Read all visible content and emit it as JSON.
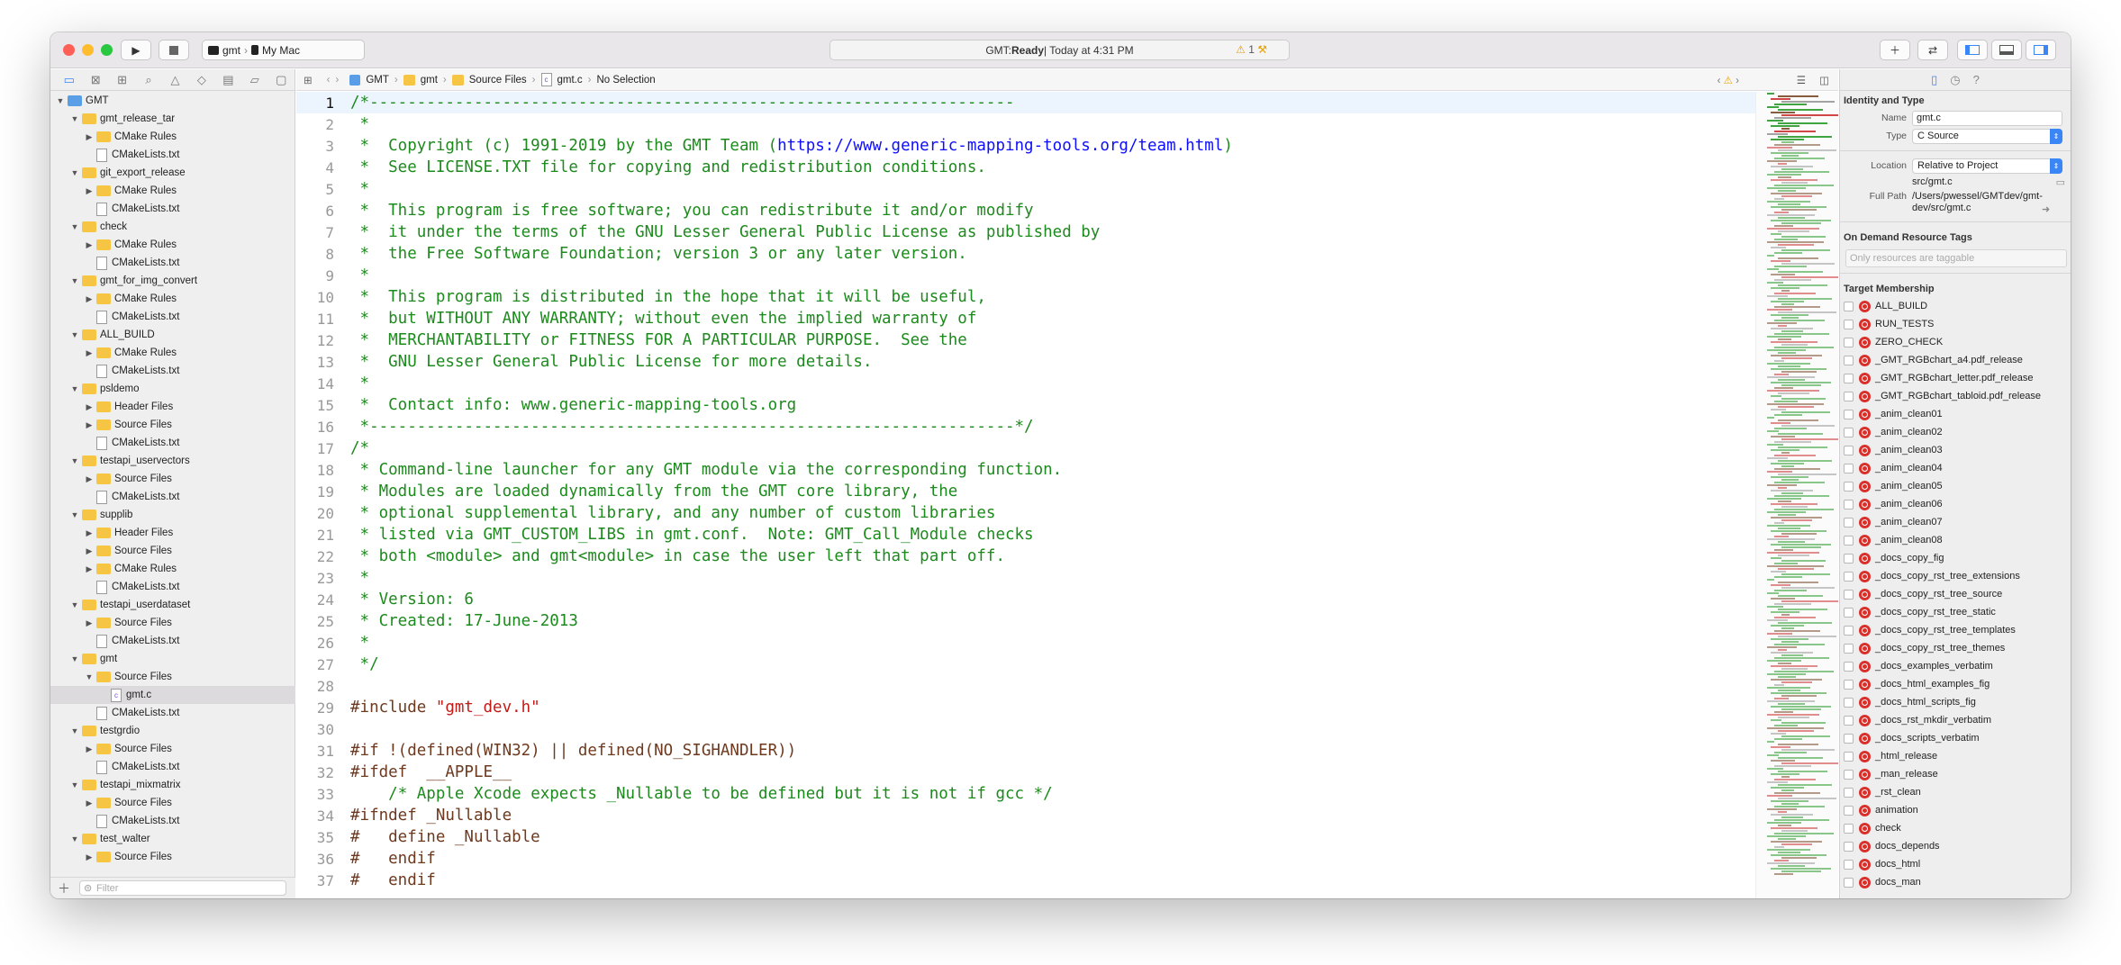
{
  "toolbar": {
    "scheme_target": "gmt",
    "scheme_device": "My Mac",
    "activity_app": "GMT: ",
    "activity_status": "Ready",
    "activity_time": " | Today at 4:31 PM",
    "warning_count": "1"
  },
  "jumpbar": {
    "crumbs": [
      "GMT",
      "gmt",
      "Source Files",
      "gmt.c"
    ],
    "selection": "No Selection"
  },
  "navigator": {
    "filter_placeholder": "Filter",
    "items": [
      {
        "label": "GMT",
        "depth": 0,
        "kind": "project",
        "tri": "▼"
      },
      {
        "label": "gmt_release_tar",
        "depth": 1,
        "kind": "folder",
        "tri": "▼"
      },
      {
        "label": "CMake Rules",
        "depth": 2,
        "kind": "folder",
        "tri": "▶"
      },
      {
        "label": "CMakeLists.txt",
        "depth": 2,
        "kind": "file",
        "tri": ""
      },
      {
        "label": "git_export_release",
        "depth": 1,
        "kind": "folder",
        "tri": "▼"
      },
      {
        "label": "CMake Rules",
        "depth": 2,
        "kind": "folder",
        "tri": "▶"
      },
      {
        "label": "CMakeLists.txt",
        "depth": 2,
        "kind": "file",
        "tri": ""
      },
      {
        "label": "check",
        "depth": 1,
        "kind": "folder",
        "tri": "▼"
      },
      {
        "label": "CMake Rules",
        "depth": 2,
        "kind": "folder",
        "tri": "▶"
      },
      {
        "label": "CMakeLists.txt",
        "depth": 2,
        "kind": "file",
        "tri": ""
      },
      {
        "label": "gmt_for_img_convert",
        "depth": 1,
        "kind": "folder",
        "tri": "▼"
      },
      {
        "label": "CMake Rules",
        "depth": 2,
        "kind": "folder",
        "tri": "▶"
      },
      {
        "label": "CMakeLists.txt",
        "depth": 2,
        "kind": "file",
        "tri": ""
      },
      {
        "label": "ALL_BUILD",
        "depth": 1,
        "kind": "folder",
        "tri": "▼"
      },
      {
        "label": "CMake Rules",
        "depth": 2,
        "kind": "folder",
        "tri": "▶"
      },
      {
        "label": "CMakeLists.txt",
        "depth": 2,
        "kind": "file",
        "tri": ""
      },
      {
        "label": "psldemo",
        "depth": 1,
        "kind": "folder",
        "tri": "▼"
      },
      {
        "label": "Header Files",
        "depth": 2,
        "kind": "folder",
        "tri": "▶"
      },
      {
        "label": "Source Files",
        "depth": 2,
        "kind": "folder",
        "tri": "▶"
      },
      {
        "label": "CMakeLists.txt",
        "depth": 2,
        "kind": "file",
        "tri": ""
      },
      {
        "label": "testapi_uservectors",
        "depth": 1,
        "kind": "folder",
        "tri": "▼"
      },
      {
        "label": "Source Files",
        "depth": 2,
        "kind": "folder",
        "tri": "▶"
      },
      {
        "label": "CMakeLists.txt",
        "depth": 2,
        "kind": "file",
        "tri": ""
      },
      {
        "label": "supplib",
        "depth": 1,
        "kind": "folder",
        "tri": "▼"
      },
      {
        "label": "Header Files",
        "depth": 2,
        "kind": "folder",
        "tri": "▶"
      },
      {
        "label": "Source Files",
        "depth": 2,
        "kind": "folder",
        "tri": "▶"
      },
      {
        "label": "CMake Rules",
        "depth": 2,
        "kind": "folder",
        "tri": "▶"
      },
      {
        "label": "CMakeLists.txt",
        "depth": 2,
        "kind": "file",
        "tri": ""
      },
      {
        "label": "testapi_userdataset",
        "depth": 1,
        "kind": "folder",
        "tri": "▼"
      },
      {
        "label": "Source Files",
        "depth": 2,
        "kind": "folder",
        "tri": "▶"
      },
      {
        "label": "CMakeLists.txt",
        "depth": 2,
        "kind": "file",
        "tri": ""
      },
      {
        "label": "gmt",
        "depth": 1,
        "kind": "folder",
        "tri": "▼"
      },
      {
        "label": "Source Files",
        "depth": 2,
        "kind": "folder",
        "tri": "▼"
      },
      {
        "label": "gmt.c",
        "depth": 3,
        "kind": "cfile",
        "tri": "",
        "selected": true
      },
      {
        "label": "CMakeLists.txt",
        "depth": 2,
        "kind": "file",
        "tri": ""
      },
      {
        "label": "testgrdio",
        "depth": 1,
        "kind": "folder",
        "tri": "▼"
      },
      {
        "label": "Source Files",
        "depth": 2,
        "kind": "folder",
        "tri": "▶"
      },
      {
        "label": "CMakeLists.txt",
        "depth": 2,
        "kind": "file",
        "tri": ""
      },
      {
        "label": "testapi_mixmatrix",
        "depth": 1,
        "kind": "folder",
        "tri": "▼"
      },
      {
        "label": "Source Files",
        "depth": 2,
        "kind": "folder",
        "tri": "▶"
      },
      {
        "label": "CMakeLists.txt",
        "depth": 2,
        "kind": "file",
        "tri": ""
      },
      {
        "label": "test_walter",
        "depth": 1,
        "kind": "folder",
        "tri": "▼"
      },
      {
        "label": "Source Files",
        "depth": 2,
        "kind": "folder",
        "tri": "▶"
      }
    ]
  },
  "code": [
    {
      "n": "1",
      "t": "/*--------------------------------------------------------------------",
      "c": "c-com"
    },
    {
      "n": "2",
      "t": " *",
      "c": "c-com"
    },
    {
      "n": "3",
      "t": " *  Copyright (c) 1991-2019 by the GMT Team (",
      "c": "c-com",
      "url": "https://www.generic-mapping-tools.org/team.html",
      "after": ")"
    },
    {
      "n": "4",
      "t": " *  See LICENSE.TXT file for copying and redistribution conditions.",
      "c": "c-com"
    },
    {
      "n": "5",
      "t": " *",
      "c": "c-com"
    },
    {
      "n": "6",
      "t": " *  This program is free software; you can redistribute it and/or modify",
      "c": "c-com"
    },
    {
      "n": "7",
      "t": " *  it under the terms of the GNU Lesser General Public License as published by",
      "c": "c-com"
    },
    {
      "n": "8",
      "t": " *  the Free Software Foundation; version 3 or any later version.",
      "c": "c-com"
    },
    {
      "n": "9",
      "t": " *",
      "c": "c-com"
    },
    {
      "n": "10",
      "t": " *  This program is distributed in the hope that it will be useful,",
      "c": "c-com"
    },
    {
      "n": "11",
      "t": " *  but WITHOUT ANY WARRANTY; without even the implied warranty of",
      "c": "c-com"
    },
    {
      "n": "12",
      "t": " *  MERCHANTABILITY or FITNESS FOR A PARTICULAR PURPOSE.  See the",
      "c": "c-com"
    },
    {
      "n": "13",
      "t": " *  GNU Lesser General Public License for more details.",
      "c": "c-com"
    },
    {
      "n": "14",
      "t": " *",
      "c": "c-com"
    },
    {
      "n": "15",
      "t": " *  Contact info: www.generic-mapping-tools.org",
      "c": "c-com"
    },
    {
      "n": "16",
      "t": " *--------------------------------------------------------------------*/",
      "c": "c-com"
    },
    {
      "n": "17",
      "t": "/*",
      "c": "c-com"
    },
    {
      "n": "18",
      "t": " * Command-line launcher for any GMT module via the corresponding function.",
      "c": "c-com"
    },
    {
      "n": "19",
      "t": " * Modules are loaded dynamically from the GMT core library, the",
      "c": "c-com"
    },
    {
      "n": "20",
      "t": " * optional supplemental library, and any number of custom libraries",
      "c": "c-com"
    },
    {
      "n": "21",
      "t": " * listed via GMT_CUSTOM_LIBS in gmt.conf.  Note: GMT_Call_Module checks",
      "c": "c-com"
    },
    {
      "n": "22",
      "t": " * both <module> and gmt<module> in case the user left that part off.",
      "c": "c-com"
    },
    {
      "n": "23",
      "t": " *",
      "c": "c-com"
    },
    {
      "n": "24",
      "t": " * Version: 6",
      "c": "c-com"
    },
    {
      "n": "25",
      "t": " * Created: 17-June-2013",
      "c": "c-com"
    },
    {
      "n": "26",
      "t": " *",
      "c": "c-com"
    },
    {
      "n": "27",
      "t": " */",
      "c": "c-com"
    },
    {
      "n": "28",
      "t": "",
      "c": ""
    },
    {
      "n": "29",
      "t": "#include ",
      "c": "c-pp",
      "str": "\"gmt_dev.h\""
    },
    {
      "n": "30",
      "t": "",
      "c": ""
    },
    {
      "n": "31",
      "t": "#if !(defined(WIN32) || defined(NO_SIGHANDLER))",
      "c": "c-pp"
    },
    {
      "n": "32",
      "t": "#ifdef  __APPLE__",
      "c": "c-pp"
    },
    {
      "n": "33",
      "t": "    ",
      "c": "c-pp",
      "com": "/* Apple Xcode expects _Nullable to be defined but it is not if gcc */"
    },
    {
      "n": "34",
      "t": "#ifndef _Nullable",
      "c": "c-pp"
    },
    {
      "n": "35",
      "t": "#   define _Nullable",
      "c": "c-pp"
    },
    {
      "n": "36",
      "t": "#   endif",
      "c": "c-pp"
    },
    {
      "n": "37",
      "t": "#   endif",
      "c": "c-pp"
    }
  ],
  "inspector": {
    "identity_title": "Identity and Type",
    "name_label": "Name",
    "name_value": "gmt.c",
    "type_label": "Type",
    "type_value": "C Source",
    "location_label": "Location",
    "location_value": "Relative to Project",
    "location_path": "src/gmt.c",
    "fullpath_label": "Full Path",
    "fullpath_value": "/Users/pwessel/GMTdev/gmt-dev/src/gmt.c",
    "tags_title": "On Demand Resource Tags",
    "tags_placeholder": "Only resources are taggable",
    "membership_title": "Target Membership",
    "targets": [
      "ALL_BUILD",
      "RUN_TESTS",
      "ZERO_CHECK",
      "_GMT_RGBchart_a4.pdf_release",
      "_GMT_RGBchart_letter.pdf_release",
      "_GMT_RGBchart_tabloid.pdf_release",
      "_anim_clean01",
      "_anim_clean02",
      "_anim_clean03",
      "_anim_clean04",
      "_anim_clean05",
      "_anim_clean06",
      "_anim_clean07",
      "_anim_clean08",
      "_docs_copy_fig",
      "_docs_copy_rst_tree_extensions",
      "_docs_copy_rst_tree_source",
      "_docs_copy_rst_tree_static",
      "_docs_copy_rst_tree_templates",
      "_docs_copy_rst_tree_themes",
      "_docs_examples_verbatim",
      "_docs_html_examples_fig",
      "_docs_html_scripts_fig",
      "_docs_rst_mkdir_verbatim",
      "_docs_scripts_verbatim",
      "_html_release",
      "_man_release",
      "_rst_clean",
      "animation",
      "check",
      "docs_depends",
      "docs_html",
      "docs_man"
    ]
  }
}
